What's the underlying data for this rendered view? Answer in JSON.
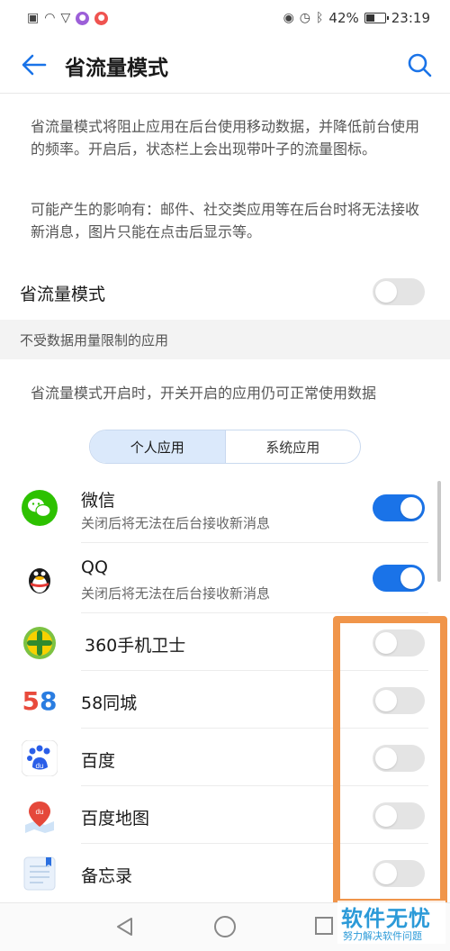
{
  "status": {
    "battery": "42%",
    "time": "23:19"
  },
  "header": {
    "title": "省流量模式"
  },
  "description": {
    "p1": "省流量模式将阻止应用在后台使用移动数据，并降低前台使用的频率。开启后，状态栏上会出现带叶子的流量图标。",
    "p2": "可能产生的影响有：邮件、社交类应用等在后台时将无法接收新消息，图片只能在点击后显示等。"
  },
  "saver_toggle": {
    "label": "省流量模式",
    "on": false
  },
  "section": {
    "title": "不受数据用量限制的应用",
    "hint": "省流量模式开启时，开关开启的应用仍可正常使用数据"
  },
  "tabs": [
    {
      "label": "个人应用",
      "active": true
    },
    {
      "label": "系统应用",
      "active": false
    }
  ],
  "apps": [
    {
      "name": "微信",
      "subtitle": "关闭后将无法在后台接收新消息",
      "on": true
    },
    {
      "name": "QQ",
      "subtitle": "关闭后将无法在后台接收新消息",
      "on": true
    },
    {
      "name": "360手机卫士",
      "subtitle": "",
      "on": false
    },
    {
      "name": "58同城",
      "subtitle": "",
      "on": false
    },
    {
      "name": "百度",
      "subtitle": "",
      "on": false
    },
    {
      "name": "百度地图",
      "subtitle": "",
      "on": false
    },
    {
      "name": "备忘录",
      "subtitle": "",
      "on": false
    }
  ],
  "icon_labels": {
    "app58_5": "5",
    "app58_8": "8",
    "baidu": "du",
    "baidumap": "du"
  },
  "watermark": {
    "main": "软件无忧",
    "sub": "努力解决软件问题"
  },
  "colors": {
    "accent": "#1a73e8",
    "highlight": "#f0954a",
    "watermark": "#2b9ad8"
  }
}
